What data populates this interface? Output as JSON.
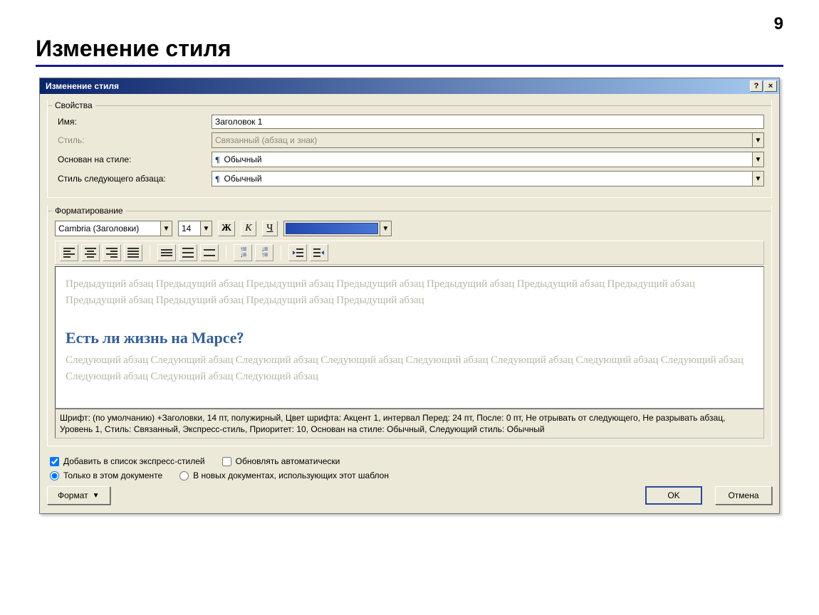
{
  "page": {
    "number": "9",
    "title": "Изменение стиля"
  },
  "dialog": {
    "title": "Изменение стиля",
    "help": "?",
    "close": "×"
  },
  "properties": {
    "legend": "Свойства",
    "name_label": "Имя:",
    "name_value": "Заголовок 1",
    "styletype_label": "Стиль:",
    "styletype_value": "Связанный (абзац и знак)",
    "basedon_label": "Основан на стиле:",
    "basedon_value": "Обычный",
    "nextstyle_label": "Стиль следующего абзаца:",
    "nextstyle_value": "Обычный"
  },
  "formatting": {
    "legend": "Форматирование",
    "font": "Cambria (Заголовки)",
    "size": "14",
    "bold": "Ж",
    "italic": "К",
    "underline": "Ч"
  },
  "preview": {
    "prev_para": "Предыдущий абзац Предыдущий абзац Предыдущий абзац Предыдущий абзац Предыдущий абзац Предыдущий абзац Предыдущий абзац Предыдущий абзац Предыдущий абзац Предыдущий абзац Предыдущий абзац",
    "heading": "Есть ли жизнь на Марсе?",
    "next_para": "Следующий абзац Следующий абзац Следующий абзац Следующий абзац Следующий абзац Следующий абзац Следующий абзац Следующий абзац Следующий абзац Следующий абзац Следующий абзац"
  },
  "description": "Шрифт: (по умолчанию) +Заголовки, 14 пт, полужирный, Цвет шрифта: Акцент 1, интервал Перед: 24 пт, После: 0 пт, Не отрывать от следующего, Не разрывать абзац, Уровень 1, Стиль: Связанный, Экспресс-стиль, Приоритет: 10, Основан на стиле: Обычный, Следующий стиль: Обычный",
  "options": {
    "add_to_quick": "Добавить в список экспресс-стилей",
    "auto_update": "Обновлять автоматически",
    "only_this_doc": "Только в этом документе",
    "new_docs": "В новых документах, использующих этот шаблон"
  },
  "buttons": {
    "format": "Формат",
    "ok": "OK",
    "cancel": "Отмена"
  }
}
